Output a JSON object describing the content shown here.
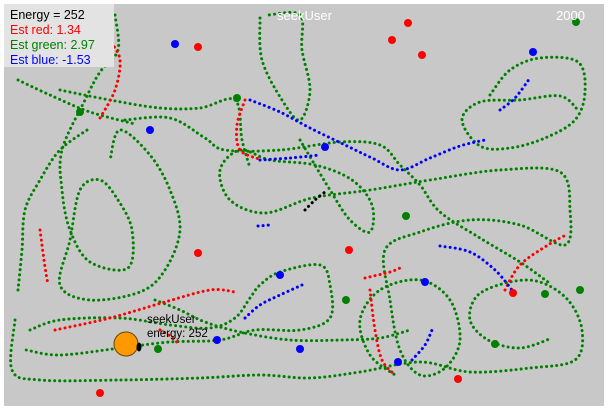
{
  "game": {
    "title": "seekUser",
    "step_counter": "2000",
    "stats": {
      "energy": "Energy = 252",
      "est_red": "Est red: 1.34",
      "est_green": "Est green: 2.97",
      "est_blue": "Est blue: -1.53"
    },
    "agent": {
      "name_label": "seekUser",
      "energy_label": "energy: 252"
    }
  },
  "colors": {
    "background": "#c8c8c8",
    "stats_panel": "#e3e3e3",
    "red": "#ff0000",
    "green": "#008000",
    "blue": "#0000ff",
    "agent_fill": "#ff9900",
    "title_text": "#ffffff"
  },
  "legend": {
    "red_food": "red-dot",
    "green_food": "green-dot",
    "blue_food": "blue-dot",
    "agent": "orange-circle"
  }
}
